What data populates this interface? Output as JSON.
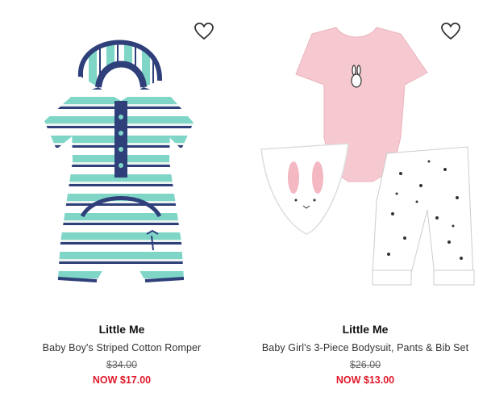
{
  "colors": {
    "sale": "#e11a2b",
    "heart_stroke": "#333333"
  },
  "products": [
    {
      "brand": "Little Me",
      "name": "Baby Boy's Striped Cotton Romper",
      "original_price": "$34.00",
      "sale_price": "NOW $17.00",
      "wishlist_icon": "heart-outline-icon"
    },
    {
      "brand": "Little Me",
      "name": "Baby Girl's 3-Piece Bodysuit, Pants & Bib Set",
      "original_price": "$26.00",
      "sale_price": "NOW $13.00",
      "wishlist_icon": "heart-outline-icon"
    }
  ]
}
